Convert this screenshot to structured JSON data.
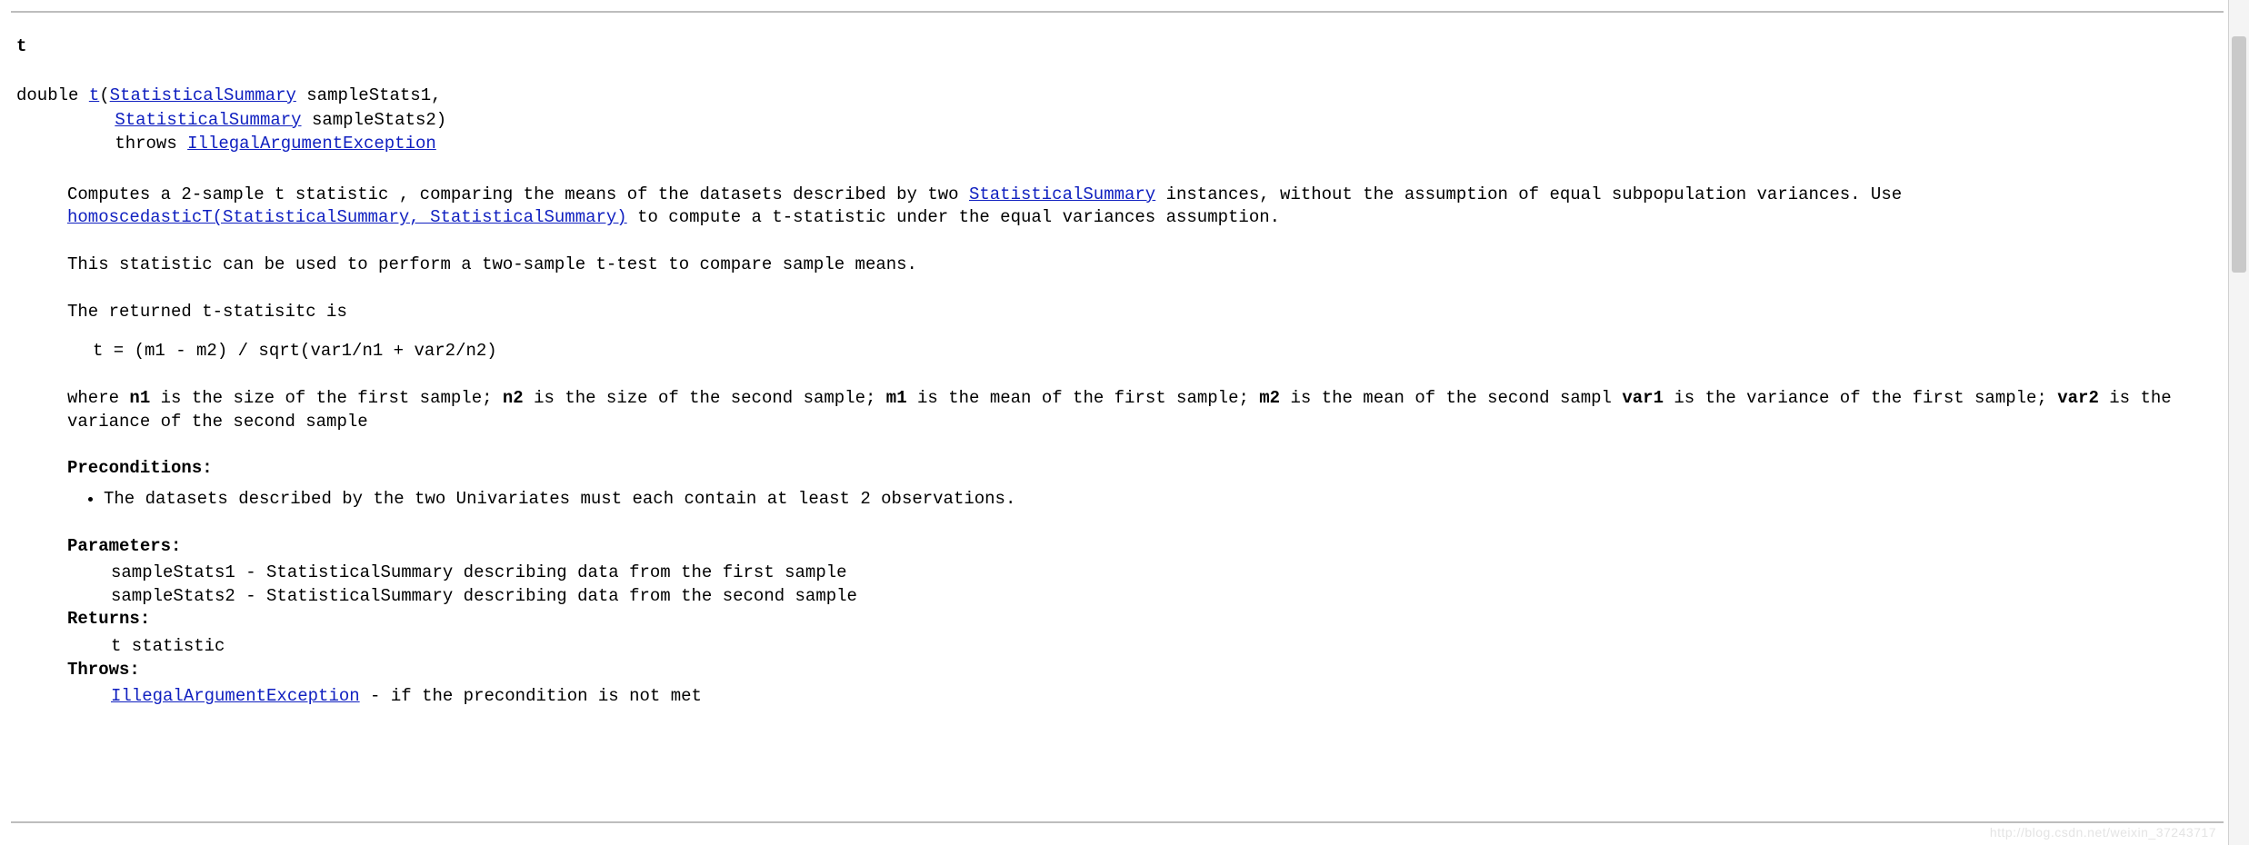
{
  "method": {
    "name": "t",
    "signature": {
      "return_type": "double",
      "method_link": "t",
      "param1_type_link": "StatisticalSummary",
      "param1_name": "sampleStats1",
      "param2_type_link": "StatisticalSummary",
      "param2_name": "sampleStats2",
      "throws_kw": "throws",
      "throws_link": "IllegalArgumentException"
    }
  },
  "desc": {
    "p1_a": "Computes a 2-sample t statistic , comparing the means of the datasets described by two ",
    "p1_link1": "StatisticalSummary",
    "p1_b": " instances, without the assumption of equal subpopulation variances. Use ",
    "p1_link2": "homoscedasticT(StatisticalSummary, StatisticalSummary)",
    "p1_c": " to compute a t-statistic under the equal variances assumption.",
    "p2": "This statistic can be used to perform a two-sample t-test to compare sample means.",
    "p3": "The returned t-statisitc is",
    "formula": "t = (m1 - m2) / sqrt(var1/n1 + var2/n2)",
    "where_pre": "where ",
    "n1": "n1",
    "where_a": " is the size of the first sample; ",
    "n2": "n2",
    "where_b": " is the size of the second sample; ",
    "m1": "m1",
    "where_c": " is the mean of the first sample; ",
    "m2": "m2",
    "where_d": " is the mean of the second sampl ",
    "var1": "var1",
    "where_e": " is the variance of the first sample; ",
    "var2": "var2",
    "where_f": " is the variance of the second sample"
  },
  "preconditions": {
    "label": "Preconditions",
    "items": [
      "The datasets described by the two Univariates must each contain at least 2 observations."
    ]
  },
  "parameters": {
    "label": "Parameters:",
    "items": [
      "sampleStats1 - StatisticalSummary describing data from the first sample",
      "sampleStats2 - StatisticalSummary describing data from the second sample"
    ]
  },
  "returns": {
    "label": "Returns:",
    "value": "t statistic"
  },
  "throws": {
    "label": "Throws:",
    "link": "IllegalArgumentException",
    "tail": " - if the precondition is not met"
  },
  "watermark": "http://blog.csdn.net/weixin_37243717"
}
